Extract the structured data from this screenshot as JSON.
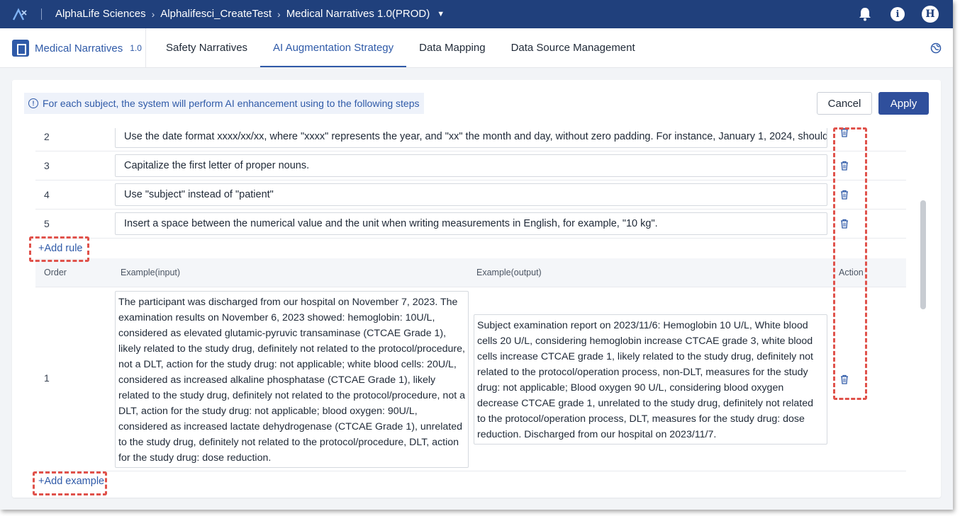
{
  "topbar": {
    "org": "AlphaLife Sciences",
    "project": "Alphalifesci_CreateTest",
    "app": "Medical Narratives 1.0(PROD)",
    "icons": [
      "bell-icon",
      "info-icon",
      "avatar"
    ],
    "avatar_letter": "H"
  },
  "nav": {
    "brand": "Medical Narratives",
    "version": "1.0",
    "tabs": [
      {
        "label": "Safety Narratives"
      },
      {
        "label": "AI Augmentation Strategy"
      },
      {
        "label": "Data Mapping"
      },
      {
        "label": "Data Source Management"
      }
    ],
    "active_tab": "AI Augmentation Strategy"
  },
  "notice": "For each subject, the system will perform AI enhancement using to the following steps",
  "buttons": {
    "cancel": "Cancel",
    "apply": "Apply"
  },
  "rules": [
    {
      "order": "2",
      "text": "Use the date format xxxx/xx/xx, where \"xxxx\" represents the year, and \"xx\" the month and day, without zero padding. For instance, January 1, 2024, should"
    },
    {
      "order": "3",
      "text": "Capitalize the first letter of proper nouns."
    },
    {
      "order": "4",
      "text": "Use \"subject\" instead of \"patient\""
    },
    {
      "order": "5",
      "text": "Insert a space between the numerical value and the unit when writing measurements in English, for example, \"10 kg\"."
    }
  ],
  "add_rule": "+Add rule",
  "examples_table": {
    "headers": {
      "order": "Order",
      "input": "Example(input)",
      "output": "Example(output)",
      "action": "Action"
    },
    "rows": [
      {
        "order": "1",
        "input": "The participant was discharged from our hospital on November 7, 2023. The examination results on November 6, 2023 showed: hemoglobin: 10U/L, considered as elevated glutamic-pyruvic transaminase (CTCAE Grade 1), likely related to the study drug, definitely not related to the protocol/procedure, not a DLT, action for the study drug: not applicable; white blood cells: 20U/L, considered as increased alkaline phosphatase (CTCAE Grade 1), likely related to the study drug, definitely not related to the protocol/procedure, not a DLT, action for the study drug: not applicable; blood oxygen: 90U/L, considered as increased lactate dehydrogenase (CTCAE Grade 1), unrelated to the study drug, definitely not related to the protocol/procedure, DLT, action for the study drug: dose reduction.",
        "output": "Subject examination report on 2023/11/6: Hemoglobin 10 U/L, White blood cells 20 U/L, considering hemoglobin increase CTCAE grade 3, white blood cells increase CTCAE grade 1, likely related to the study drug, definitely not related to the protocol/operation process, non-DLT, measures for the study drug: not applicable; Blood oxygen 90 U/L, considering blood oxygen decrease CTCAE grade 1, unrelated to the study drug, definitely not related to the protocol/operation process, DLT, measures for the study drug: dose reduction. Discharged from our hospital on 2023/11/7."
      }
    ]
  },
  "add_example": "+Add example",
  "colors": {
    "topbar": "#20407c",
    "accent": "#2f5aa8",
    "apply": "#2f4f9c",
    "highlight": "#e0524b"
  }
}
